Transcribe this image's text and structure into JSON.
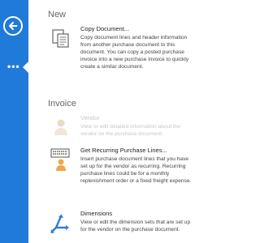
{
  "sections": {
    "new": {
      "title": "New",
      "actions": [
        {
          "title": "Copy Document...",
          "description": "Copy document lines and header information from another purchase document to this document. You can copy a posted purchase invoice into a new purchase invoice to quickly create a similar document.",
          "icon": "copy-document-icon",
          "enabled": true
        }
      ]
    },
    "invoice": {
      "title": "Invoice",
      "actions": [
        {
          "title": "Vendor",
          "description": "View or edit detailed information about the vendor on the purchase document.",
          "icon": "vendor-icon",
          "enabled": false
        },
        {
          "title": "Get Recurring Purchase Lines...",
          "description": "Insert purchase document lines that you have set up for the vendor as recurring. Recurring purchase lines could be for a monthly replenishment order or a fixed freight expense.",
          "icon": "recurring-lines-icon",
          "enabled": true
        },
        {
          "title": "Dimensions",
          "description": "View or edit the dimension sets that are set up for the vendor on the purchase document.",
          "icon": "dimensions-icon",
          "enabled": true
        }
      ]
    }
  },
  "sidebar": {
    "back_icon": "back-arrow-icon",
    "more_icon": "more-icon"
  },
  "colors": {
    "sidebar": "#1f7ad9",
    "icon_blue": "#2a7fd4",
    "icon_orange": "#f3a64a",
    "disabled": "#c8c8c8"
  }
}
